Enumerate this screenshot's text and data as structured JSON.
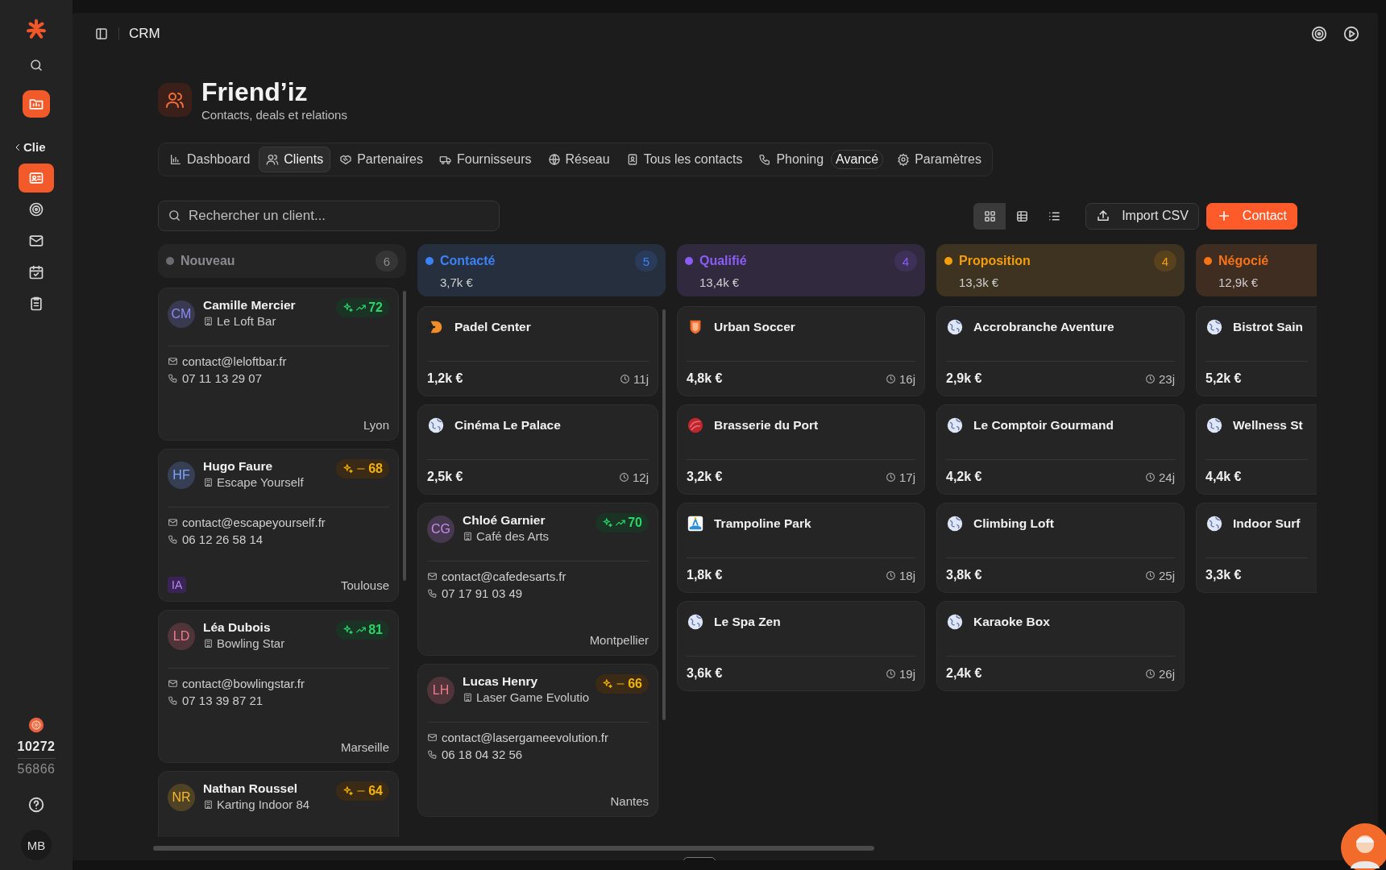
{
  "sidebar": {
    "back_label": "Clie",
    "nav": [
      {
        "selected": true
      },
      {
        "selected": false
      },
      {
        "selected": false
      },
      {
        "selected": false
      },
      {
        "selected": false
      }
    ],
    "credits": {
      "used": "10272",
      "total": "56866"
    },
    "user": {
      "initials": "MB"
    }
  },
  "topbar": {
    "title": "CRM"
  },
  "page": {
    "title": "Friend’iz",
    "subtitle": "Contacts, deals et relations"
  },
  "tabs": [
    {
      "label": "Dashboard",
      "kind": "tab",
      "selected": false
    },
    {
      "label": "Clients",
      "kind": "tab",
      "selected": true
    },
    {
      "label": "Partenaires",
      "kind": "tab",
      "selected": false
    },
    {
      "label": "Fournisseurs",
      "kind": "tab",
      "selected": false
    },
    {
      "label": "Réseau",
      "kind": "tab",
      "selected": false
    },
    {
      "label": "Tous les contacts",
      "kind": "tab",
      "selected": false
    },
    {
      "label": "Phoning",
      "kind": "tab",
      "selected": false
    },
    {
      "label": "Avancé",
      "kind": "pill",
      "selected": false
    },
    {
      "label": "Paramètres",
      "kind": "tab",
      "selected": false
    }
  ],
  "search": {
    "placeholder": "Rechercher un client..."
  },
  "views": [
    {
      "selected": true
    },
    {
      "selected": false
    },
    {
      "selected": false
    }
  ],
  "buttons": [
    {
      "label": "Import CSV",
      "kind": "secondary"
    },
    {
      "label": "Contact",
      "kind": "primary"
    }
  ],
  "columns": [
    {
      "title": "Nouveau",
      "color": "#6b6b70",
      "count": "6",
      "scrollable": true,
      "cards": [
        {
          "kind": "contact",
          "initials": "CM",
          "color": "#8b8cf5",
          "name": "Camille Mercier",
          "company": "Le Loft Bar",
          "score": {
            "value": "72",
            "kind": "up"
          },
          "email": "contact@leloftbar.fr",
          "phone": "07 11 13 29 07",
          "city": "Lyon"
        },
        {
          "kind": "contact",
          "initials": "HF",
          "color": "#7ea8ff",
          "name": "Hugo Faure",
          "company": "Escape Yourself",
          "score": {
            "value": "68",
            "kind": "flat"
          },
          "email": "contact@escapeyourself.fr",
          "phone": "06 12 26 58 14",
          "city": "Toulouse",
          "tag": "IA"
        },
        {
          "kind": "contact",
          "initials": "LD",
          "color": "#f07a8a",
          "name": "Léa Dubois",
          "company": "Bowling Star",
          "score": {
            "value": "81",
            "kind": "up"
          },
          "email": "contact@bowlingstar.fr",
          "phone": "07 13 39 87 21",
          "city": "Marseille"
        },
        {
          "kind": "contact",
          "initials": "NR",
          "color": "#f5b82e",
          "name": "Nathan Roussel",
          "company": "Karting Indoor 84",
          "score": {
            "value": "64",
            "kind": "flat"
          }
        }
      ]
    },
    {
      "title": "Contacté",
      "color": "#3b82f6",
      "count": "5",
      "total": "3,7k €",
      "scrollable": true,
      "cards": [
        {
          "kind": "deal",
          "logo": {
            "kind": "brand"
          },
          "name": "Padel Center",
          "amount": "1,2k €",
          "age": "11j"
        },
        {
          "kind": "deal",
          "logo": {
            "kind": "generic"
          },
          "name": "Cinéma Le Palace",
          "amount": "2,5k €",
          "age": "12j"
        },
        {
          "kind": "contact",
          "initials": "CG",
          "color": "#c78af0",
          "name": "Chloé Garnier",
          "company": "Café des Arts",
          "score": {
            "value": "70",
            "kind": "up"
          },
          "email": "contact@cafedesarts.fr",
          "phone": "07 17 91 03 49",
          "city": "Montpellier"
        },
        {
          "kind": "contact",
          "initials": "LH",
          "color": "#f07a8a",
          "name": "Lucas Henry",
          "company": "Laser Game Evolutio",
          "score": {
            "value": "66",
            "kind": "flat"
          },
          "email": "contact@lasergameevolution.fr",
          "phone": "06 18 04 32 56",
          "city": "Nantes"
        }
      ]
    },
    {
      "title": "Qualifié",
      "color": "#8b5cf6",
      "count": "4",
      "total": "13,4k €",
      "scrollable": false,
      "cards": [
        {
          "kind": "deal",
          "logo": {
            "kind": "brand"
          },
          "name": "Urban Soccer",
          "amount": "4,8k €",
          "age": "16j"
        },
        {
          "kind": "deal",
          "logo": {
            "kind": "brand"
          },
          "name": "Brasserie du Port",
          "amount": "3,2k €",
          "age": "17j"
        },
        {
          "kind": "deal",
          "logo": {
            "kind": "brand"
          },
          "name": "Trampoline Park",
          "amount": "1,8k €",
          "age": "18j"
        },
        {
          "kind": "deal",
          "logo": {
            "kind": "generic"
          },
          "name": "Le Spa Zen",
          "amount": "3,6k €",
          "age": "19j"
        }
      ]
    },
    {
      "title": "Proposition",
      "color": "#f59e0b",
      "count": "4",
      "total": "13,3k €",
      "scrollable": false,
      "cards": [
        {
          "kind": "deal",
          "logo": {
            "kind": "generic"
          },
          "name": "Accrobranche Aventure",
          "amount": "2,9k €",
          "age": "23j"
        },
        {
          "kind": "deal",
          "logo": {
            "kind": "generic"
          },
          "name": "Le Comptoir Gourmand",
          "amount": "4,2k €",
          "age": "24j"
        },
        {
          "kind": "deal",
          "logo": {
            "kind": "generic"
          },
          "name": "Climbing Loft",
          "amount": "3,8k €",
          "age": "25j"
        },
        {
          "kind": "deal",
          "logo": {
            "kind": "generic"
          },
          "name": "Karaoke Box",
          "amount": "2,4k €",
          "age": "26j"
        }
      ]
    },
    {
      "title": "Négocié",
      "color": "#f97316",
      "total": "12,9k €",
      "scrollable": false,
      "cards": [
        {
          "kind": "deal",
          "logo": {
            "kind": "generic"
          },
          "name": "Bistrot Sain",
          "amount": "5,2k €"
        },
        {
          "kind": "deal",
          "logo": {
            "kind": "generic"
          },
          "name": "Wellness St",
          "amount": "4,4k €"
        },
        {
          "kind": "deal",
          "logo": {
            "kind": "generic"
          },
          "name": "Indoor Surf",
          "amount": "3,3k €"
        }
      ]
    }
  ]
}
